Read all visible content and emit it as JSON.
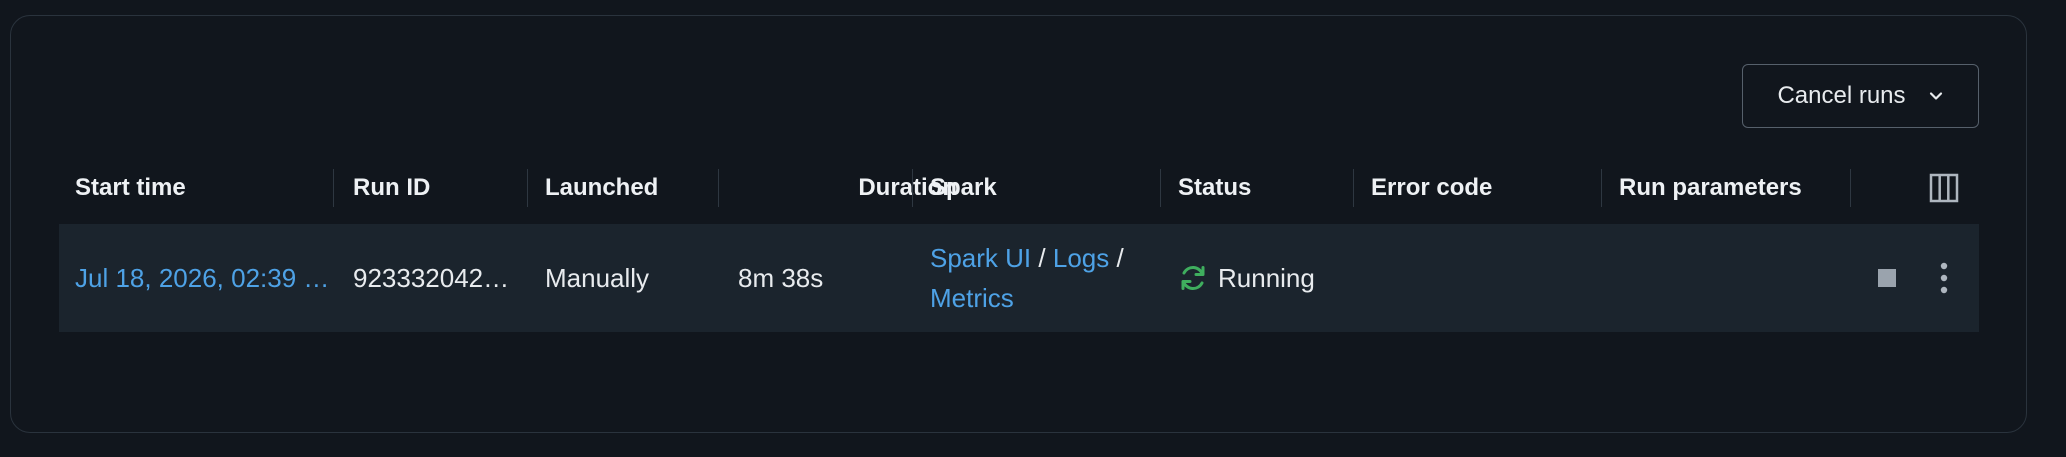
{
  "toolbar": {
    "cancel_runs_label": "Cancel runs"
  },
  "table": {
    "columns": [
      "Start time",
      "Run ID",
      "Launched",
      "Duration",
      "Spark",
      "Status",
      "Error code",
      "Run parameters"
    ],
    "rows": [
      {
        "start_time": "Jul 18, 2026, 02:39 …",
        "run_id": "923332042…",
        "launched": "Manually",
        "duration": "8m 38s",
        "spark_ui": "Spark UI",
        "logs": "Logs",
        "metrics": "Metrics",
        "separator": "/",
        "status": "Running",
        "error_code": "",
        "run_parameters": ""
      }
    ]
  },
  "colors": {
    "background": "#11161d",
    "row_background": "#1b242d",
    "link": "#4ea2e6",
    "running_icon": "#3fae5e",
    "text": "#e8ebee"
  },
  "icons": {
    "dropdown": "chevron-down-icon",
    "columns": "columns-icon",
    "status": "refresh-icon",
    "stop": "stop-icon",
    "more": "kebab-menu-icon"
  }
}
